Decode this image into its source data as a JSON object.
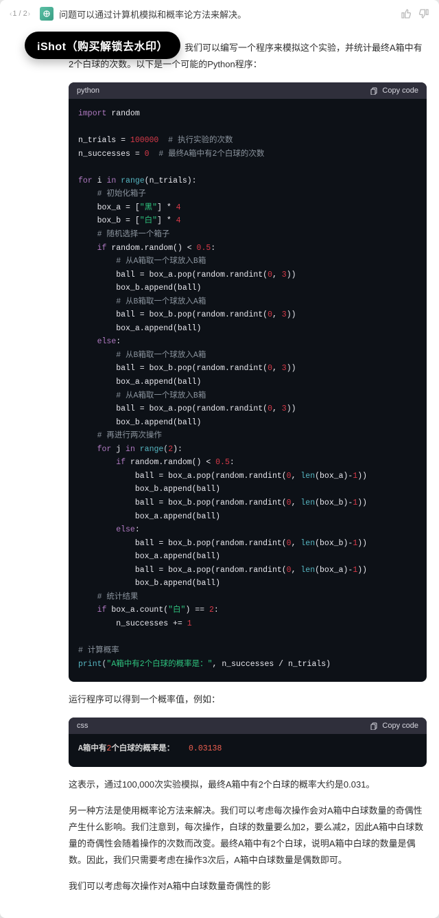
{
  "pager": {
    "label": "1 / 2"
  },
  "topline": "问题可以通过计算机模拟和概率论方法来解决。",
  "watermark_badge": "iShot（购买解锁去水印）",
  "paragraphs": {
    "p1": "为了验证计算机模拟的概率，我们可以编写一个程序来模拟这个实验，并统计最终A箱中有2个白球的次数。以下是一个可能的Python程序：",
    "p2": "运行程序可以得到一个概率值，例如：",
    "p3": "这表示，通过100,000次实验模拟，最终A箱中有2个白球的概率大约是0.031。",
    "p4": "另一种方法是使用概率论方法来解决。我们可以考虑每次操作会对A箱中白球数量的奇偶性产生什么影响。我们注意到，每次操作，白球的数量要么加2，要么减2，因此A箱中白球数量的奇偶性会随着操作的次数而改变。最终A箱中有2个白球，说明A箱中白球的数量是偶数。因此，我们只需要考虑在操作3次后，A箱中白球数量是偶数即可。",
    "p5": "我们可以考虑每次操作对A箱中白球数量奇偶性的影"
  },
  "code1": {
    "lang": "python",
    "copy": "Copy code",
    "c": {
      "import": "import",
      "random": "random",
      "n_trials": "n_trials = ",
      "n_trials_v": "100000",
      "n_trials_c": "  # 执行实验的次数",
      "n_succ": "n_successes = ",
      "n_succ_v": "0",
      "n_succ_c": "  # 最终A箱中有2个白球的次数",
      "for1": "for",
      "i": " i ",
      "in": "in",
      "range": " range",
      "lp": "(n_trials):",
      "cm_init": "# 初始化箱子",
      "boxa": "box_a = [",
      "black": "\"黑\"",
      "mul4a": "] * ",
      "four": "4",
      "boxb": "box_b = [",
      "white": "\"白\"",
      "cm_pick": "# 随机选择一个箱子",
      "if": "if",
      "rand": " random.random() < ",
      "half": "0.5",
      "colon": ":",
      "cm_a2b": "# 从A箱取一个球放入B箱",
      "l_ball_a": "ball = box_a.pop(random.randint(",
      "zero": "0",
      "comma": ", ",
      "three": "3",
      "rpp": "))",
      "app_b": "box_b.append(ball)",
      "cm_b2a": "# 从B箱取一个球放入A箱",
      "l_ball_b": "ball = box_b.pop(random.randint(",
      "app_a": "box_a.append(ball)",
      "else": "else",
      "cm_again": "# 再进行两次操作",
      "for2": "for",
      "j": " j ",
      "range2": " range",
      "two": "2",
      "rp": "):",
      "la_dyn": "ball = box_a.pop(random.randint(",
      "lb_dyn": "ball = box_b.pop(random.randint(",
      "len_a": "len",
      "tail_a": "(box_a)-",
      "one": "1",
      "tail_b": "(box_b)-",
      "cm_stat": "# 统计结果",
      "if_cnt": " box_a.count(",
      "eq": ") == ",
      "inc": "n_successes += ",
      "cm_prob": "# 计算概率",
      "print": "print",
      "pstr": "\"A箱中有2个白球的概率是：\"",
      "ptail": ", n_successes / n_trials)"
    }
  },
  "code2": {
    "lang": "css",
    "copy": "Copy code",
    "label_a": "A箱中有",
    "label_n": "2",
    "label_b": "个白球的概率是：",
    "value": "0.03138"
  }
}
